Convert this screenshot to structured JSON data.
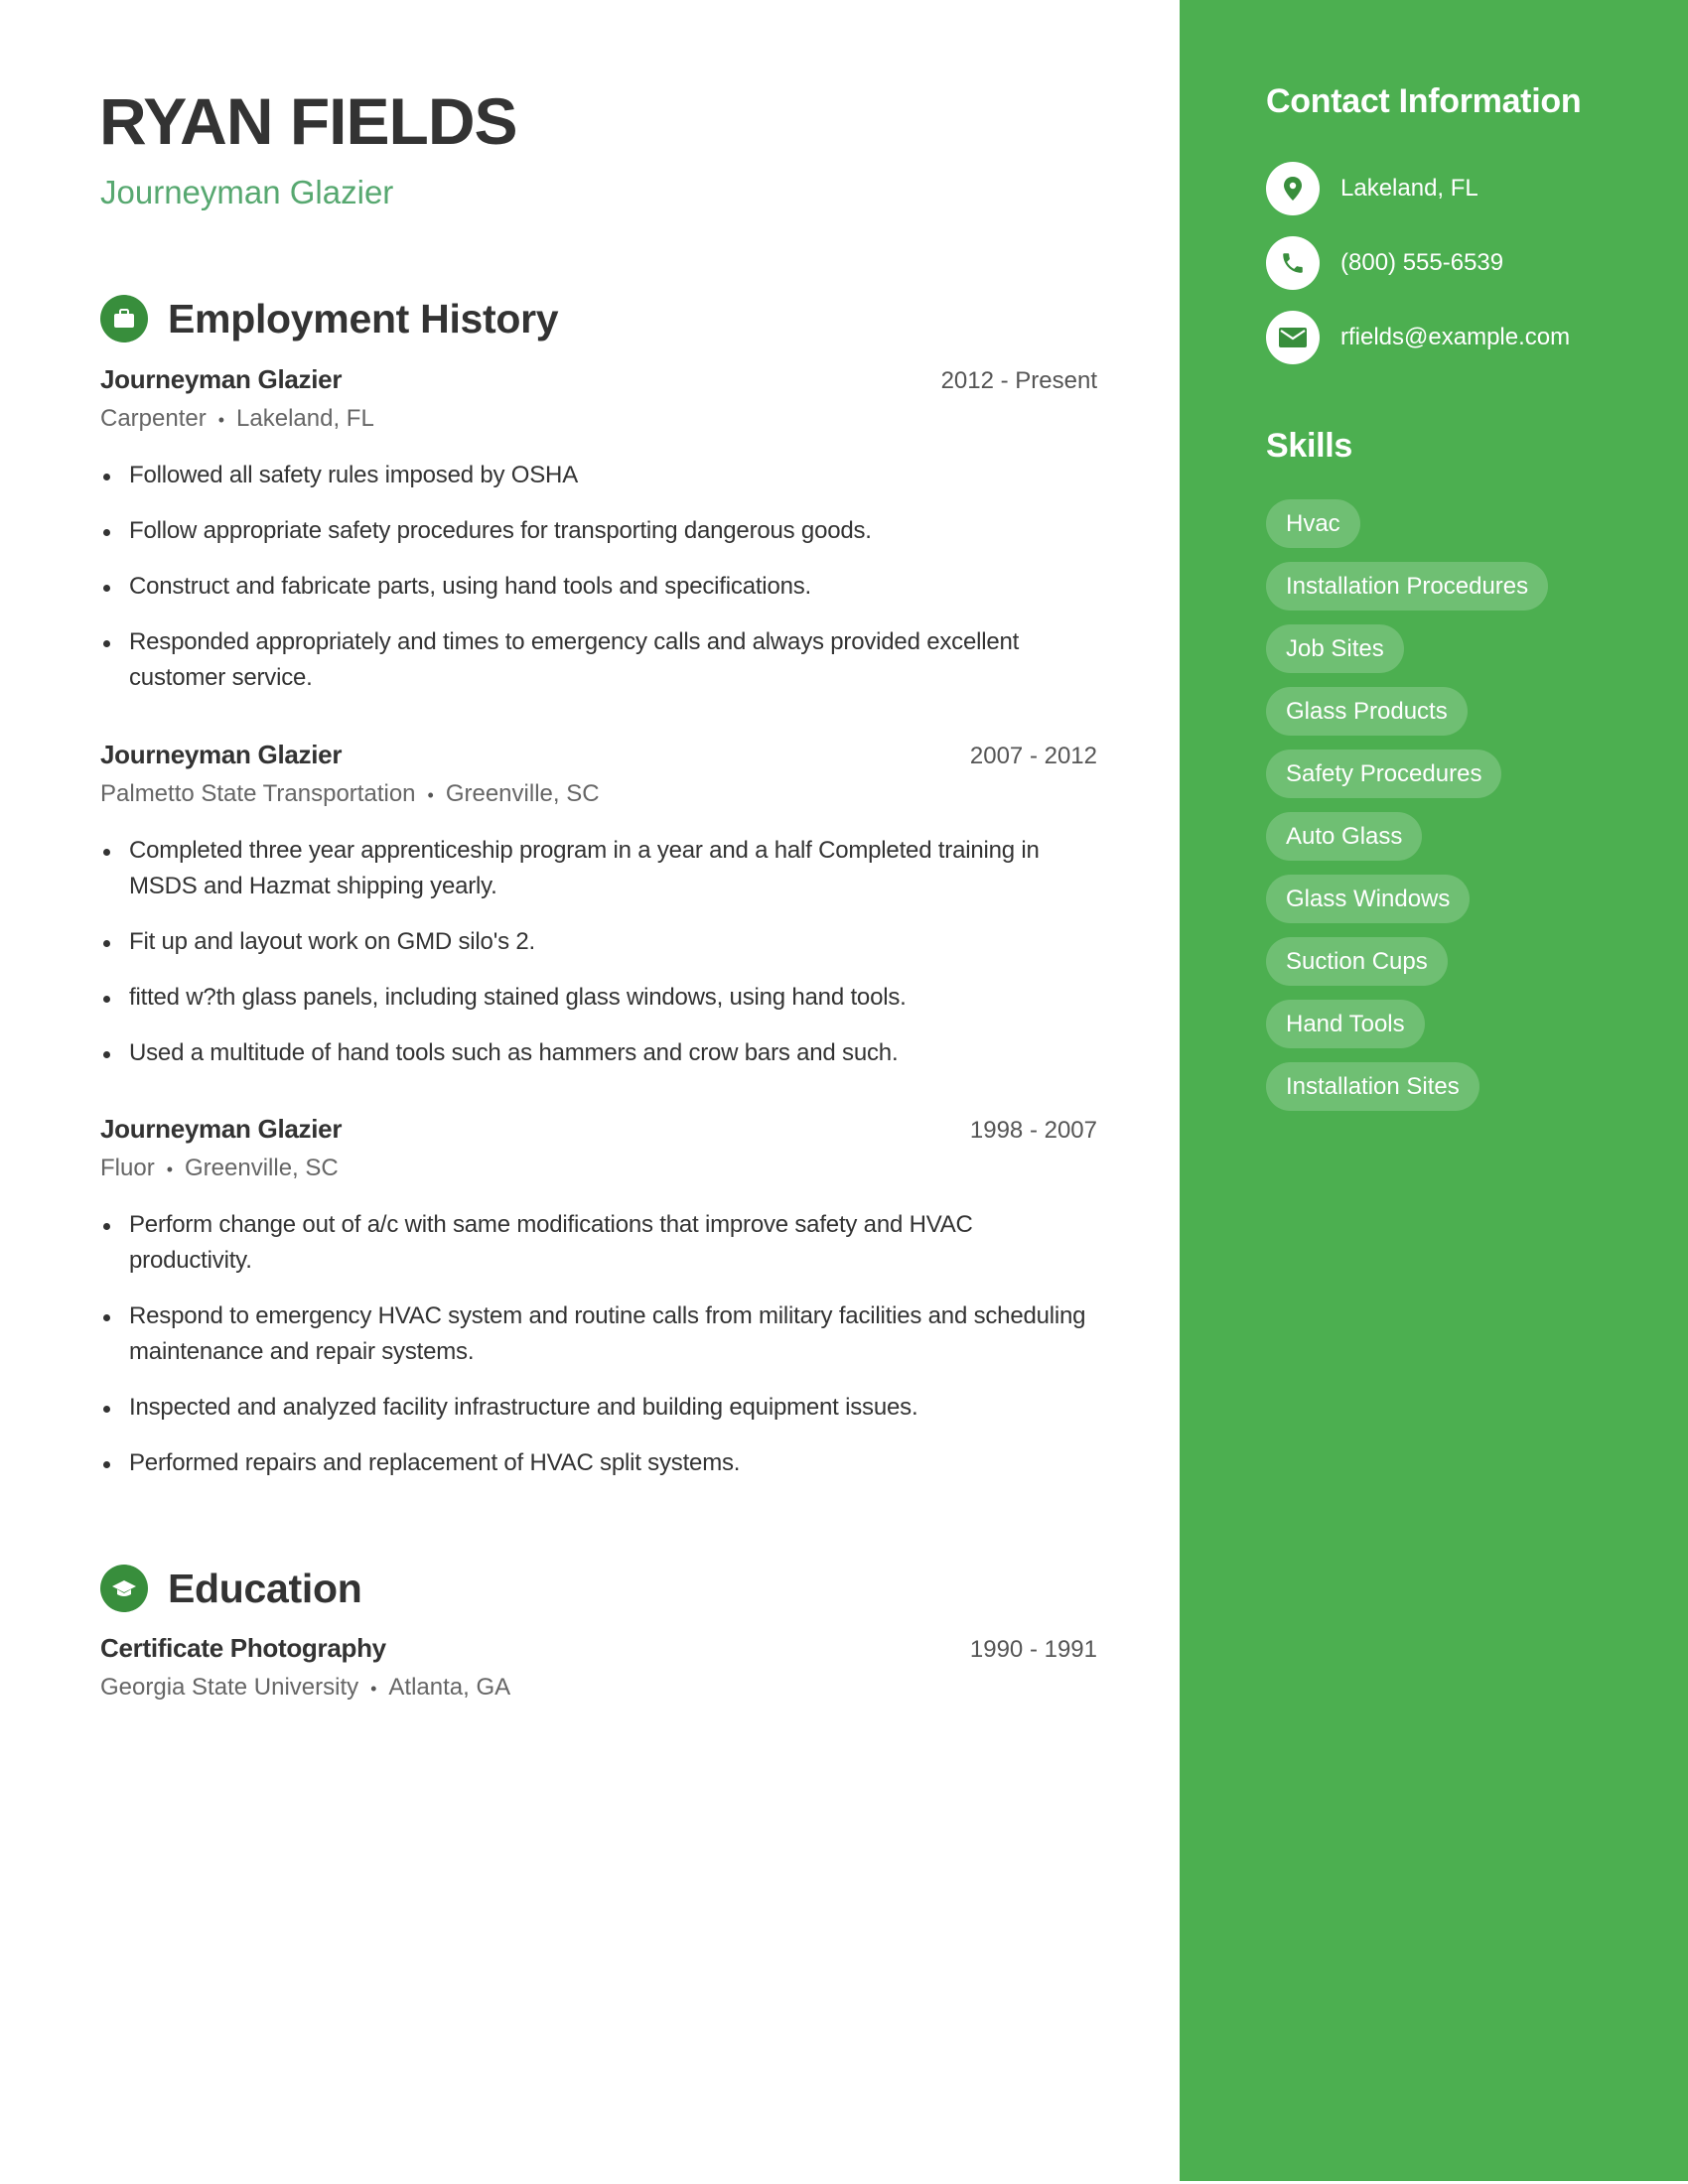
{
  "header": {
    "name": "RYAN FIELDS",
    "title": "Journeyman Glazier"
  },
  "employment": {
    "heading": "Employment History",
    "icon": "briefcase-icon",
    "jobs": [
      {
        "title": "Journeyman Glazier",
        "dates": "2012 - Present",
        "employer": "Carpenter",
        "location": "Lakeland, FL",
        "bullets": [
          "Followed all safety rules imposed by OSHA",
          "Follow appropriate safety procedures for transporting dangerous goods.",
          "Construct and fabricate parts, using hand tools and specifications.",
          "Responded appropriately and times to emergency calls and always provided excellent customer service."
        ]
      },
      {
        "title": "Journeyman Glazier",
        "dates": "2007 - 2012",
        "employer": "Palmetto State Transportation",
        "location": "Greenville, SC",
        "bullets": [
          "Completed three year apprenticeship program in a year and a half Completed training in MSDS and Hazmat shipping yearly.",
          "Fit up and layout work on GMD silo's 2.",
          "fitted w?th glass panels, including stained glass windows, using hand tools.",
          "Used a multitude of hand tools such as hammers and crow bars and such."
        ]
      },
      {
        "title": "Journeyman Glazier",
        "dates": "1998 - 2007",
        "employer": "Fluor",
        "location": "Greenville, SC",
        "bullets": [
          "Perform change out of a/c with same modifications that improve safety and HVAC productivity.",
          "Respond to emergency HVAC system and routine calls from military facilities and scheduling maintenance and repair systems.",
          "Inspected and analyzed facility infrastructure and building equipment issues.",
          "Performed repairs and replacement of HVAC split systems."
        ]
      }
    ]
  },
  "education": {
    "heading": "Education",
    "icon": "graduation-cap-icon",
    "entries": [
      {
        "title": "Certificate Photography",
        "dates": "1990 - 1991",
        "school": "Georgia State University",
        "location": "Atlanta, GA"
      }
    ]
  },
  "sidebar": {
    "contact_heading": "Contact Information",
    "contact": [
      {
        "icon": "location-pin-icon",
        "text": "Lakeland, FL"
      },
      {
        "icon": "phone-icon",
        "text": "(800) 555-6539"
      },
      {
        "icon": "envelope-icon",
        "text": "rfields@example.com"
      }
    ],
    "skills_heading": "Skills",
    "skills": [
      "Hvac",
      "Installation Procedures",
      "Job Sites",
      "Glass Products",
      "Safety Procedures",
      "Auto Glass",
      "Glass Windows",
      "Suction Cups",
      "Hand Tools",
      "Installation Sites"
    ]
  },
  "colors": {
    "sidebar_green": "#4CAF50",
    "icon_green": "#388E3C",
    "subtitle_green": "#57A870",
    "text_dark": "#333333",
    "text_muted": "#666666"
  }
}
